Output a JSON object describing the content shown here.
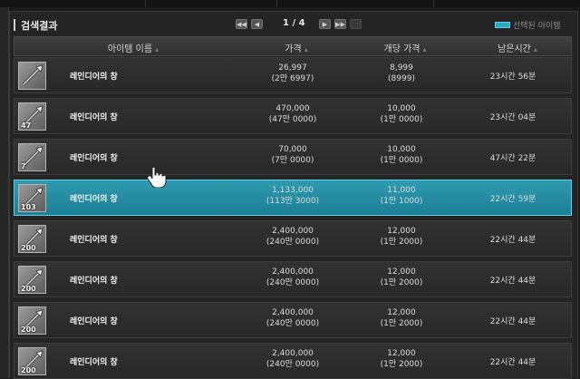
{
  "panel": {
    "title": "검색결과",
    "legend_label": "선택된 아이템",
    "accent_color": "#2aa7c2"
  },
  "pager": {
    "page_text": "1 / 4",
    "current_page": 1,
    "total_pages": 4,
    "first_icon": "first-page-icon",
    "prev_icon": "prev-page-icon",
    "next_icon": "next-page-icon",
    "last_icon": "last-page-icon"
  },
  "columns": [
    "아이템 이름",
    "가격",
    "개당 가격",
    "남은시간"
  ],
  "rows": [
    {
      "level": "",
      "name": "레인디어의 창",
      "price": "26,997",
      "price_sub": "(2만 6997)",
      "unit": "8,999",
      "unit_sub": "(8999)",
      "time": "23시간 56분",
      "selected": false
    },
    {
      "level": "47",
      "name": "레인디어의 창",
      "price": "470,000",
      "price_sub": "(47만 0000)",
      "unit": "10,000",
      "unit_sub": "(1만 0000)",
      "time": "23시간 04분",
      "selected": false
    },
    {
      "level": "7",
      "name": "레인디어의 창",
      "price": "70,000",
      "price_sub": "(7만 0000)",
      "unit": "10,000",
      "unit_sub": "(1만 0000)",
      "time": "47시간 22분",
      "selected": false
    },
    {
      "level": "103",
      "name": "레인디어의 창",
      "price": "1,133,000",
      "price_sub": "(113만 3000)",
      "unit": "11,000",
      "unit_sub": "(1만 1000)",
      "time": "22시간 59분",
      "selected": true
    },
    {
      "level": "200",
      "name": "레인디어의 창",
      "price": "2,400,000",
      "price_sub": "(240만 0000)",
      "unit": "12,000",
      "unit_sub": "(1만 2000)",
      "time": "22시간 44분",
      "selected": false
    },
    {
      "level": "200",
      "name": "레인디어의 창",
      "price": "2,400,000",
      "price_sub": "(240만 0000)",
      "unit": "12,000",
      "unit_sub": "(1만 2000)",
      "time": "22시간 44분",
      "selected": false
    },
    {
      "level": "200",
      "name": "레인디어의 창",
      "price": "2,400,000",
      "price_sub": "(240만 0000)",
      "unit": "12,000",
      "unit_sub": "(1만 2000)",
      "time": "22시간 44분",
      "selected": false
    },
    {
      "level": "200",
      "name": "레인디어의 창",
      "price": "2,400,000",
      "price_sub": "(240만 0000)",
      "unit": "12,000",
      "unit_sub": "(1만 2000)",
      "time": "22시간 44분",
      "selected": false
    }
  ]
}
